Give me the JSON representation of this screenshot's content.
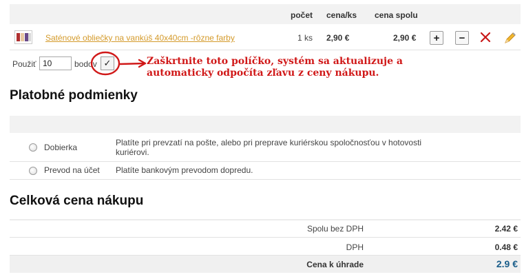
{
  "cart": {
    "columns": {
      "count": "počet",
      "unit_price": "cena/ks",
      "total_price": "cena spolu"
    },
    "item": {
      "name": "Saténové obliečky na vankúš 40x40cm -rôzne farby",
      "quantity": "1 ks",
      "unit_price": "2,90 €",
      "total_price": "2,90 €",
      "plus_label": "+",
      "minus_label": "−"
    },
    "points": {
      "use_label": "Použiť",
      "value": "10",
      "unit_label": "bodov",
      "check_label": "✓"
    }
  },
  "annotation": {
    "text": "Zaškrtnite toto políčko, systém sa aktualizuje a automaticky odpočíta zľavu z ceny nákupu.",
    "color": "#d01818"
  },
  "payment": {
    "heading": "Platobné podmienky",
    "options": [
      {
        "label": "Dobierka",
        "description": "Platíte pri prevzatí na pošte, alebo pri preprave kuriérskou spoločnosťou v hotovosti kuriérovi."
      },
      {
        "label": "Prevod na účet",
        "description": "Platíte bankovým prevodom dopredu."
      }
    ]
  },
  "summary": {
    "heading": "Celková cena nákupu",
    "rows": [
      {
        "label": "Spolu bez DPH",
        "value": "2.42 €"
      },
      {
        "label": "DPH",
        "value": "0.48 €"
      },
      {
        "label": "Cena k úhrade",
        "value": "2.9 €"
      }
    ],
    "total_color": "#1a5e8a"
  },
  "colors": {
    "link": "#d49a2a",
    "delete": "#c81818",
    "edit": "#e8a020"
  }
}
